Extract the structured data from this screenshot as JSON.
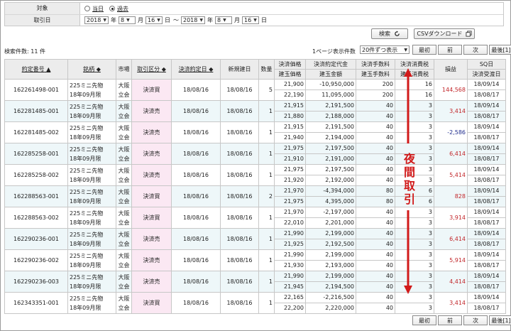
{
  "form": {
    "target_label": "対象",
    "target_options": [
      {
        "label": "当日",
        "checked": false
      },
      {
        "label": "過去",
        "checked": true
      }
    ],
    "date_label": "取引日",
    "from": {
      "year": "2018",
      "month": "8",
      "day": "16"
    },
    "to": {
      "year": "2018",
      "month": "8",
      "day": "16"
    },
    "unit_year": "年",
    "unit_month": "月",
    "unit_day": "日",
    "range_sep": "～"
  },
  "buttons": {
    "search": "検索",
    "csv": "CSVダウンロード"
  },
  "result_count": "検索件数: 11 件",
  "per_page_label": "1ページ表示件数",
  "per_page_value": "20件ずつ表示",
  "pager": {
    "first": "最初",
    "prev": "前",
    "next": "次",
    "last": "最後[1]"
  },
  "headers": {
    "contract_no": "約定番号",
    "contract_sort": "▲",
    "issue": "銘柄",
    "sort_both": "◆",
    "market": "市場",
    "trade_type": "取引区分",
    "settle_date": "決済約定日",
    "open_date": "新規建日",
    "qty": "数量",
    "price_top": "決済価格",
    "price_bottom": "建玉価格",
    "amount_top": "決済約定代金",
    "amount_bottom": "建玉金額",
    "fee_top": "決済手数料",
    "fee_bottom": "建玉手数料",
    "tax_top": "決済消費税",
    "tax_bottom": "建玉消費税",
    "pl": "損益",
    "sq_top": "SQ日",
    "sq_bottom": "決済受渡日"
  },
  "rows": [
    {
      "no": "162261498-001",
      "issue1": "225ミニ先物",
      "issue2": "18年09月限",
      "market1": "大阪",
      "market2": "立会",
      "type": "決済買",
      "settle": "18/08/16",
      "open": "18/08/16",
      "qty": "5",
      "p1": "21,900",
      "p2": "22,190",
      "a1": "-10,950,000",
      "a2": "11,095,000",
      "f1": "200",
      "f2": "200",
      "t1": "16",
      "t2": "16",
      "pl": "144,568",
      "pl_sign": "pos",
      "sq": "18/09/14",
      "del": "18/08/17"
    },
    {
      "no": "162281485-001",
      "issue1": "225ミニ先物",
      "issue2": "18年09月限",
      "market1": "大阪",
      "market2": "立会",
      "type": "決済売",
      "settle": "18/08/16",
      "open": "18/08/16",
      "qty": "1",
      "p1": "21,915",
      "p2": "21,880",
      "a1": "2,191,500",
      "a2": "2,188,000",
      "f1": "40",
      "f2": "40",
      "t1": "3",
      "t2": "3",
      "pl": "3,414",
      "pl_sign": "pos",
      "sq": "18/09/14",
      "del": "18/08/17"
    },
    {
      "no": "162281485-002",
      "issue1": "225ミニ先物",
      "issue2": "18年09月限",
      "market1": "大阪",
      "market2": "立会",
      "type": "決済売",
      "settle": "18/08/16",
      "open": "18/08/16",
      "qty": "1",
      "p1": "21,915",
      "p2": "21,940",
      "a1": "2,191,500",
      "a2": "2,194,000",
      "f1": "40",
      "f2": "40",
      "t1": "3",
      "t2": "3",
      "pl": "-2,586",
      "pl_sign": "neg",
      "sq": "18/09/14",
      "del": "18/08/17"
    },
    {
      "no": "162285258-001",
      "issue1": "225ミニ先物",
      "issue2": "18年09月限",
      "market1": "大阪",
      "market2": "立会",
      "type": "決済売",
      "settle": "18/08/16",
      "open": "18/08/16",
      "qty": "1",
      "p1": "21,975",
      "p2": "21,910",
      "a1": "2,197,500",
      "a2": "2,191,000",
      "f1": "40",
      "f2": "40",
      "t1": "3",
      "t2": "3",
      "pl": "6,414",
      "pl_sign": "pos",
      "sq": "18/09/14",
      "del": "18/08/17"
    },
    {
      "no": "162285258-002",
      "issue1": "225ミニ先物",
      "issue2": "18年09月限",
      "market1": "大阪",
      "market2": "立会",
      "type": "決済売",
      "settle": "18/08/16",
      "open": "18/08/16",
      "qty": "1",
      "p1": "21,975",
      "p2": "21,920",
      "a1": "2,197,500",
      "a2": "2,192,000",
      "f1": "40",
      "f2": "40",
      "t1": "3",
      "t2": "3",
      "pl": "5,414",
      "pl_sign": "pos",
      "sq": "18/09/14",
      "del": "18/08/17"
    },
    {
      "no": "162288563-001",
      "issue1": "225ミニ先物",
      "issue2": "18年09月限",
      "market1": "大阪",
      "market2": "立会",
      "type": "決済買",
      "settle": "18/08/16",
      "open": "18/08/16",
      "qty": "2",
      "p1": "21,970",
      "p2": "21,975",
      "a1": "-4,394,000",
      "a2": "4,395,000",
      "f1": "80",
      "f2": "80",
      "t1": "6",
      "t2": "6",
      "pl": "828",
      "pl_sign": "pos",
      "sq": "18/09/14",
      "del": "18/08/17"
    },
    {
      "no": "162288563-002",
      "issue1": "225ミニ先物",
      "issue2": "18年09月限",
      "market1": "大阪",
      "market2": "立会",
      "type": "決済買",
      "settle": "18/08/16",
      "open": "18/08/16",
      "qty": "1",
      "p1": "21,970",
      "p2": "22,010",
      "a1": "-2,197,000",
      "a2": "2,201,000",
      "f1": "40",
      "f2": "40",
      "t1": "3",
      "t2": "3",
      "pl": "3,914",
      "pl_sign": "pos",
      "sq": "18/09/14",
      "del": "18/08/17"
    },
    {
      "no": "162290236-001",
      "issue1": "225ミニ先物",
      "issue2": "18年09月限",
      "market1": "大阪",
      "market2": "立会",
      "type": "決済売",
      "settle": "18/08/16",
      "open": "18/08/16",
      "qty": "1",
      "p1": "21,990",
      "p2": "21,925",
      "a1": "2,199,000",
      "a2": "2,192,500",
      "f1": "40",
      "f2": "40",
      "t1": "3",
      "t2": "3",
      "pl": "6,414",
      "pl_sign": "pos",
      "sq": "18/09/14",
      "del": "18/08/17"
    },
    {
      "no": "162290236-002",
      "issue1": "225ミニ先物",
      "issue2": "18年09月限",
      "market1": "大阪",
      "market2": "立会",
      "type": "決済売",
      "settle": "18/08/16",
      "open": "18/08/16",
      "qty": "1",
      "p1": "21,990",
      "p2": "21,930",
      "a1": "2,199,000",
      "a2": "2,193,000",
      "f1": "40",
      "f2": "40",
      "t1": "3",
      "t2": "3",
      "pl": "5,914",
      "pl_sign": "pos",
      "sq": "18/09/14",
      "del": "18/08/17"
    },
    {
      "no": "162290236-003",
      "issue1": "225ミニ先物",
      "issue2": "18年09月限",
      "market1": "大阪",
      "market2": "立会",
      "type": "決済売",
      "settle": "18/08/16",
      "open": "18/08/16",
      "qty": "1",
      "p1": "21,990",
      "p2": "21,945",
      "a1": "2,199,000",
      "a2": "2,194,500",
      "f1": "40",
      "f2": "40",
      "t1": "3",
      "t2": "3",
      "pl": "4,414",
      "pl_sign": "pos",
      "sq": "18/09/14",
      "del": "18/08/17"
    },
    {
      "no": "162343351-001",
      "issue1": "225ミニ先物",
      "issue2": "18年09月限",
      "market1": "大阪",
      "market2": "立会",
      "type": "決済買",
      "settle": "18/08/16",
      "open": "18/08/16",
      "qty": "1",
      "p1": "22,165",
      "p2": "22,200",
      "a1": "-2,216,500",
      "a2": "2,220,000",
      "f1": "40",
      "f2": "40",
      "t1": "3",
      "t2": "3",
      "pl": "3,414",
      "pl_sign": "pos",
      "sq": "18/09/14",
      "del": "18/08/17"
    }
  ],
  "annotation": {
    "text": "夜間取引",
    "color": "#d11a1a"
  }
}
